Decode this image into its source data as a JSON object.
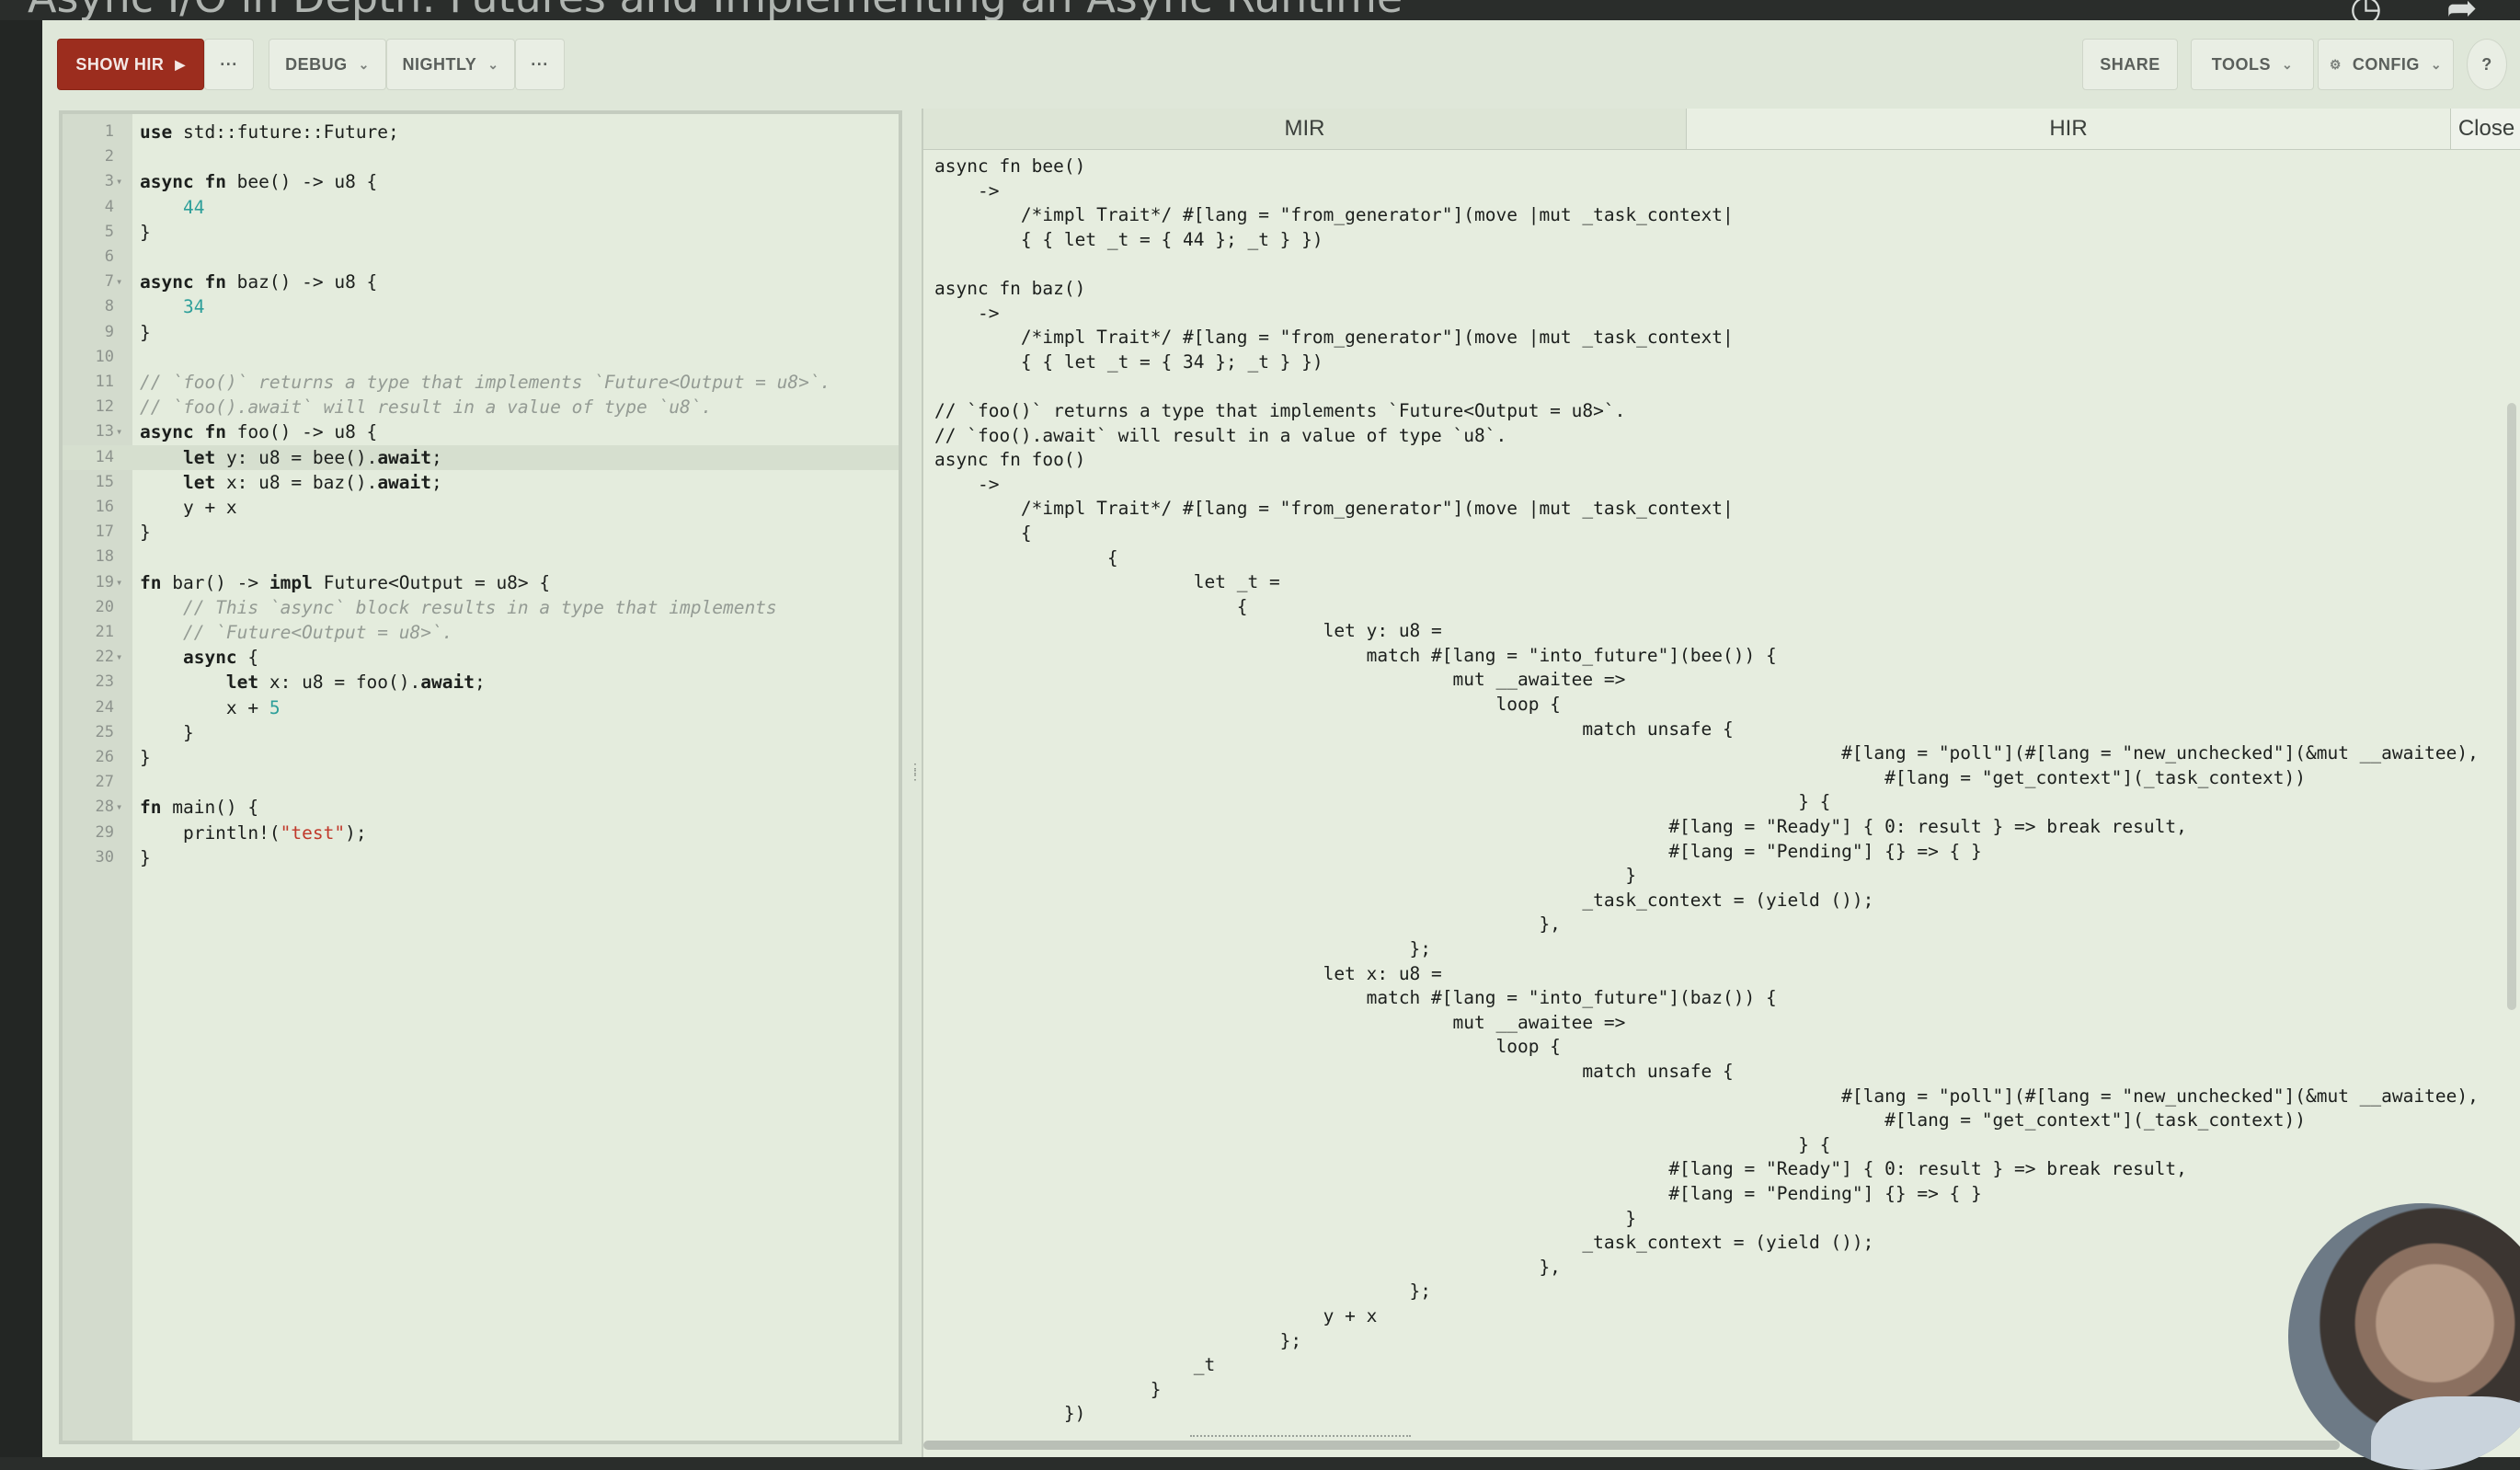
{
  "video_title": "Async I/O in Depth: Futures and Implementing an Async Runtime",
  "toolbar": {
    "show_hir": "SHOW HIR",
    "more1": "···",
    "debug": "DEBUG",
    "nightly": "NIGHTLY",
    "more2": "···",
    "share": "SHARE",
    "tools": "TOOLS",
    "config": "CONFIG",
    "help": "?"
  },
  "editor": {
    "lines": [
      {
        "n": "1",
        "t": "use std::future::Future;"
      },
      {
        "n": "2",
        "t": ""
      },
      {
        "n": "3",
        "t": "async fn bee() -> u8 {"
      },
      {
        "n": "4",
        "t": "    44"
      },
      {
        "n": "5",
        "t": "}"
      },
      {
        "n": "6",
        "t": ""
      },
      {
        "n": "7",
        "t": "async fn baz() -> u8 {"
      },
      {
        "n": "8",
        "t": "    34"
      },
      {
        "n": "9",
        "t": "}"
      },
      {
        "n": "10",
        "t": ""
      },
      {
        "n": "11",
        "t": "// `foo()` returns a type that implements `Future<Output = u8>`."
      },
      {
        "n": "12",
        "t": "// `foo().await` will result in a value of type `u8`."
      },
      {
        "n": "13",
        "t": "async fn foo() -> u8 {"
      },
      {
        "n": "14",
        "t": "    let y: u8 = bee().await;"
      },
      {
        "n": "15",
        "t": "    let x: u8 = baz().await;"
      },
      {
        "n": "16",
        "t": "    y + x"
      },
      {
        "n": "17",
        "t": "}"
      },
      {
        "n": "18",
        "t": ""
      },
      {
        "n": "19",
        "t": "fn bar() -> impl Future<Output = u8> {"
      },
      {
        "n": "20",
        "t": "    // This `async` block results in a type that implements"
      },
      {
        "n": "21",
        "t": "    // `Future<Output = u8>`."
      },
      {
        "n": "22",
        "t": "    async {"
      },
      {
        "n": "23",
        "t": "        let x: u8 = foo().await;"
      },
      {
        "n": "24",
        "t": "        x + 5"
      },
      {
        "n": "25",
        "t": "    }"
      },
      {
        "n": "26",
        "t": "}"
      },
      {
        "n": "27",
        "t": ""
      },
      {
        "n": "28",
        "t": "fn main() {"
      },
      {
        "n": "29",
        "t": "    println!(\"test\");"
      },
      {
        "n": "30",
        "t": "}"
      }
    ]
  },
  "output": {
    "tab_mir": "MIR",
    "tab_hir": "HIR",
    "close": "Close",
    "hir_text": "async fn bee()\n    ->\n        /*impl Trait*/ #[lang = \"from_generator\"](move |mut _task_context|\n        { { let _t = { 44 }; _t } })\n\nasync fn baz()\n    ->\n        /*impl Trait*/ #[lang = \"from_generator\"](move |mut _task_context|\n        { { let _t = { 34 }; _t } })\n\n// `foo()` returns a type that implements `Future<Output = u8>`.\n// `foo().await` will result in a value of type `u8`.\nasync fn foo()\n    ->\n        /*impl Trait*/ #[lang = \"from_generator\"](move |mut _task_context|\n        {\n                {\n                        let _t =\n                            {\n                                    let y: u8 =\n                                        match #[lang = \"into_future\"](bee()) {\n                                                mut __awaitee =>\n                                                    loop {\n                                                            match unsafe {\n                                                                                    #[lang = \"poll\"](#[lang = \"new_unchecked\"](&mut __awaitee),\n                                                                                        #[lang = \"get_context\"](_task_context))\n                                                                                } {\n                                                                    #[lang = \"Ready\"] { 0: result } => break result,\n                                                                    #[lang = \"Pending\"] {} => { }\n                                                                }\n                                                            _task_context = (yield ());\n                                                        },\n                                            };\n                                    let x: u8 =\n                                        match #[lang = \"into_future\"](baz()) {\n                                                mut __awaitee =>\n                                                    loop {\n                                                            match unsafe {\n                                                                                    #[lang = \"poll\"](#[lang = \"new_unchecked\"](&mut __awaitee),\n                                                                                        #[lang = \"get_context\"](_task_context))\n                                                                                } {\n                                                                    #[lang = \"Ready\"] { 0: result } => break result,\n                                                                    #[lang = \"Pending\"] {} => { }\n                                                                }\n                                                            _task_context = (yield ());\n                                                        },\n                                            };\n                                    y + x\n                                };\n                        _t\n                    }\n            })"
  },
  "colors": {
    "primary_button": "#9c2d1e",
    "editor_bg": "#e4ecdd",
    "number": "#2e9f9a",
    "string": "#c0392b",
    "comment": "#949b94"
  }
}
